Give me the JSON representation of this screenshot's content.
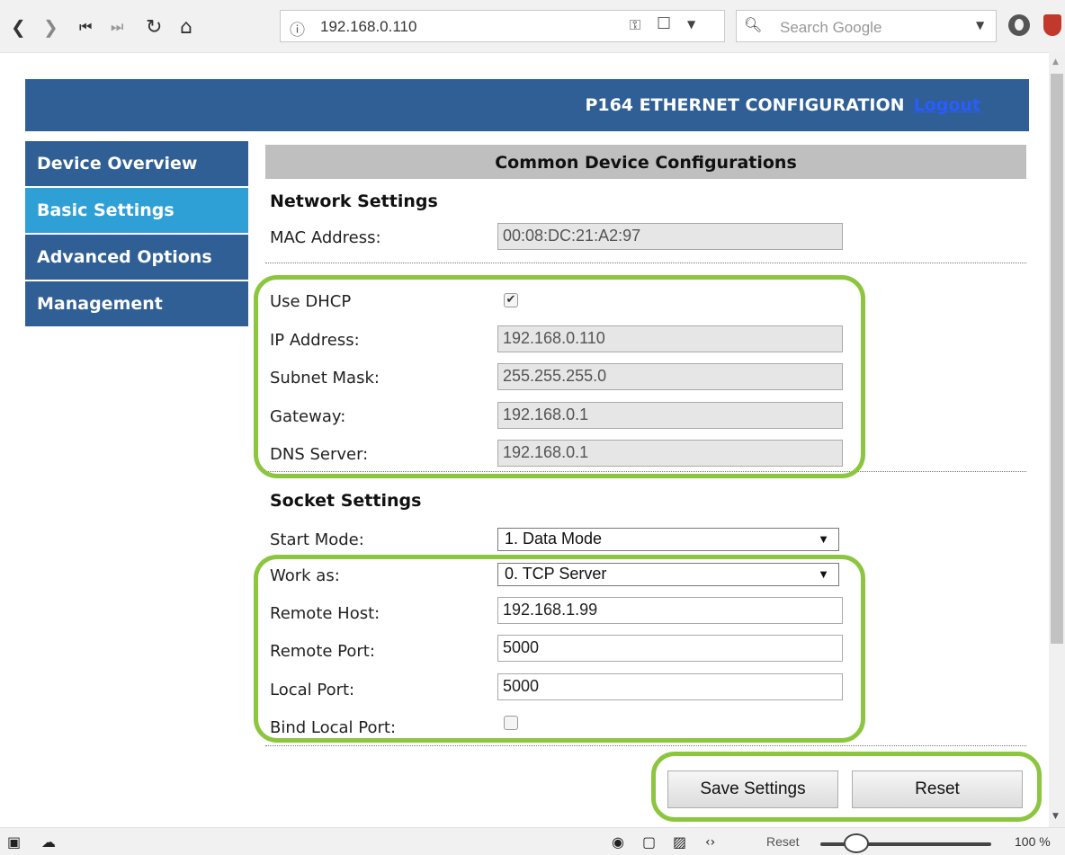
{
  "browser": {
    "url": "192.168.0.110",
    "search_placeholder": "Search Google",
    "icons": [
      "back-icon",
      "forward-icon",
      "first-icon",
      "last-icon",
      "reload-icon",
      "home-icon",
      "info-icon",
      "key-icon",
      "bookmark-icon",
      "search-icon",
      "profile-icon",
      "extension-icon"
    ]
  },
  "header": {
    "title": "P164 ETHERNET CONFIGURATION",
    "logout": "Logout"
  },
  "sidebar": {
    "items": [
      {
        "label": "Device Overview",
        "active": false
      },
      {
        "label": "Basic Settings",
        "active": true
      },
      {
        "label": "Advanced Options",
        "active": false
      },
      {
        "label": "Management",
        "active": false
      }
    ]
  },
  "main": {
    "section_title": "Common Device Configurations",
    "network": {
      "heading": "Network Settings",
      "mac_label": "MAC Address:",
      "mac_value": "00:08:DC:21:A2:97",
      "dhcp_label": "Use DHCP",
      "dhcp_checked": true,
      "ip_label": "IP Address:",
      "ip_value": "192.168.0.110",
      "subnet_label": "Subnet Mask:",
      "subnet_value": "255.255.255.0",
      "gateway_label": "Gateway:",
      "gateway_value": "192.168.0.1",
      "dns_label": "DNS Server:",
      "dns_value": "192.168.0.1"
    },
    "socket": {
      "heading": "Socket Settings",
      "start_mode_label": "Start Mode:",
      "start_mode_value": "1. Data Mode",
      "work_as_label": "Work as:",
      "work_as_value": "0. TCP Server",
      "remote_host_label": "Remote Host:",
      "remote_host_value": "192.168.1.99",
      "remote_port_label": "Remote Port:",
      "remote_port_value": "5000",
      "local_port_label": "Local Port:",
      "local_port_value": "5000",
      "bind_label": "Bind Local Port:",
      "bind_checked": false
    },
    "buttons": {
      "save": "Save Settings",
      "reset": "Reset"
    }
  },
  "statusbar": {
    "reset_label": "Reset",
    "zoom": "100 %",
    "zoom_level_percent": 100
  },
  "colors": {
    "header_bg": "#2f5f95",
    "active_tab": "#2fa0d5",
    "highlight": "#8cc63f"
  }
}
